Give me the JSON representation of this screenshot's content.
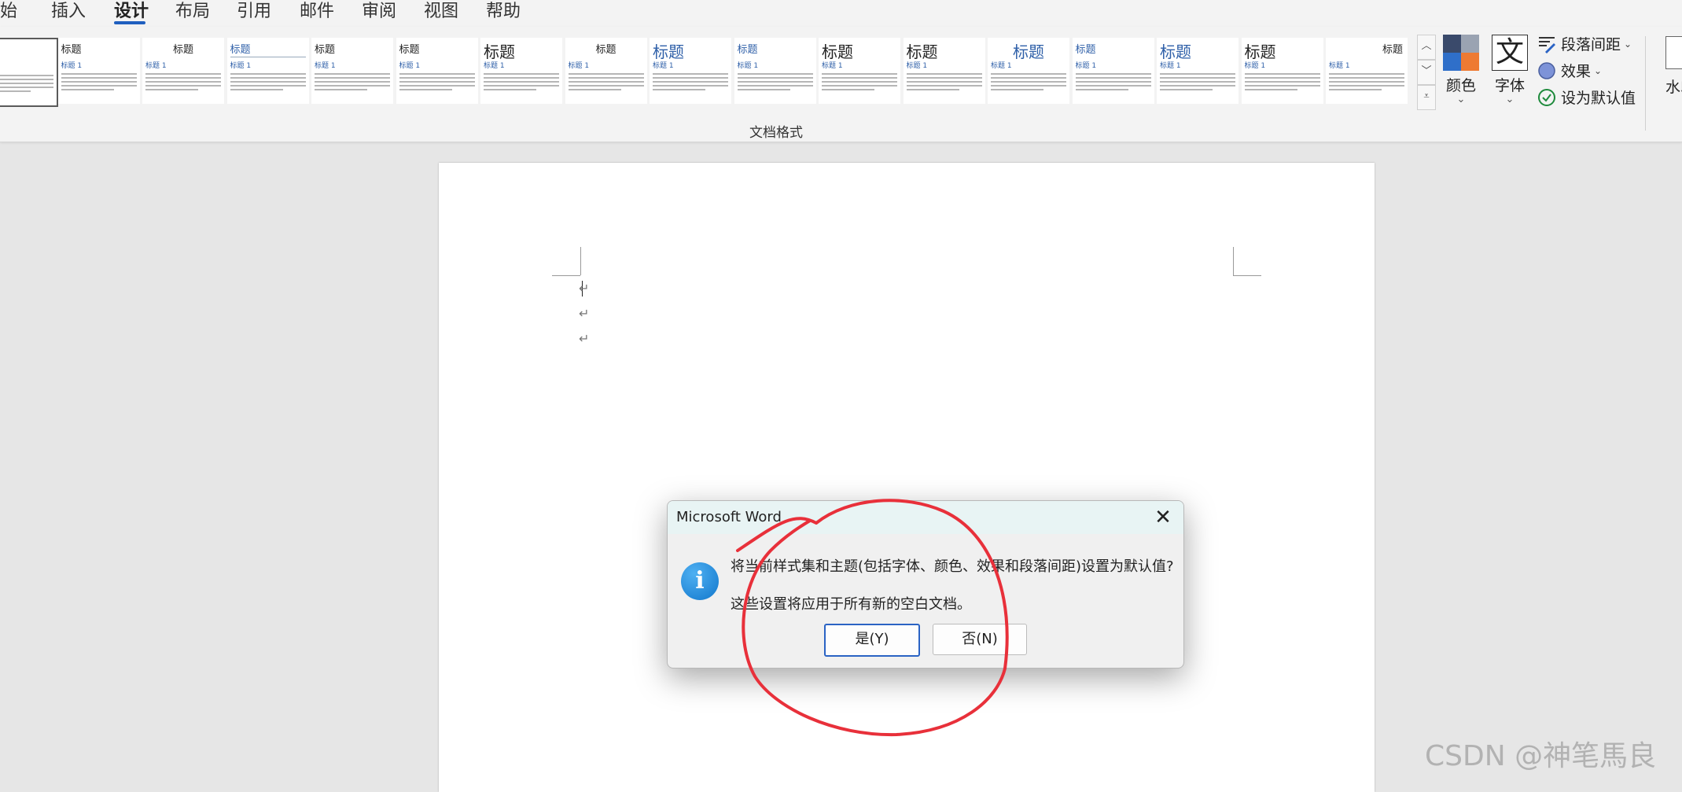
{
  "tabs": {
    "items": [
      {
        "label": "开始"
      },
      {
        "label": "插入"
      },
      {
        "label": "设计"
      },
      {
        "label": "布局"
      },
      {
        "label": "引用"
      },
      {
        "label": "邮件"
      },
      {
        "label": "审阅"
      },
      {
        "label": "视图"
      },
      {
        "label": "帮助"
      }
    ],
    "visible_first_label": "始",
    "active": "设计"
  },
  "ribbon": {
    "gallery_title_text": "标题",
    "gallery_heading1_text": "标题 1",
    "section_label": "文档格式",
    "colors_label": "颜色",
    "fonts_label": "字体",
    "fonts_icon_char": "文",
    "paragraph_spacing_label": "段落间距",
    "effects_label": "效果",
    "set_default_label": "设为默认值",
    "watermark_label": "水印",
    "color_swatches": [
      "#3a4a6b",
      "#9aa3b2",
      "#2f6fc9",
      "#ee7a32"
    ]
  },
  "document": {
    "paragraph_mark": "↵"
  },
  "dialog": {
    "title": "Microsoft Word",
    "message_line1": "将当前样式集和主题(包括字体、颜色、效果和段落间距)设置为默认值?",
    "message_line2": "这些设置将应用于所有新的空白文档。",
    "yes_button": "是(Y)",
    "no_button": "否(N)",
    "info_icon_char": "i",
    "close_char": "✕"
  },
  "watermark": {
    "text": "CSDN @神笔馬良"
  },
  "annotation": {
    "color": "#e8303a"
  }
}
